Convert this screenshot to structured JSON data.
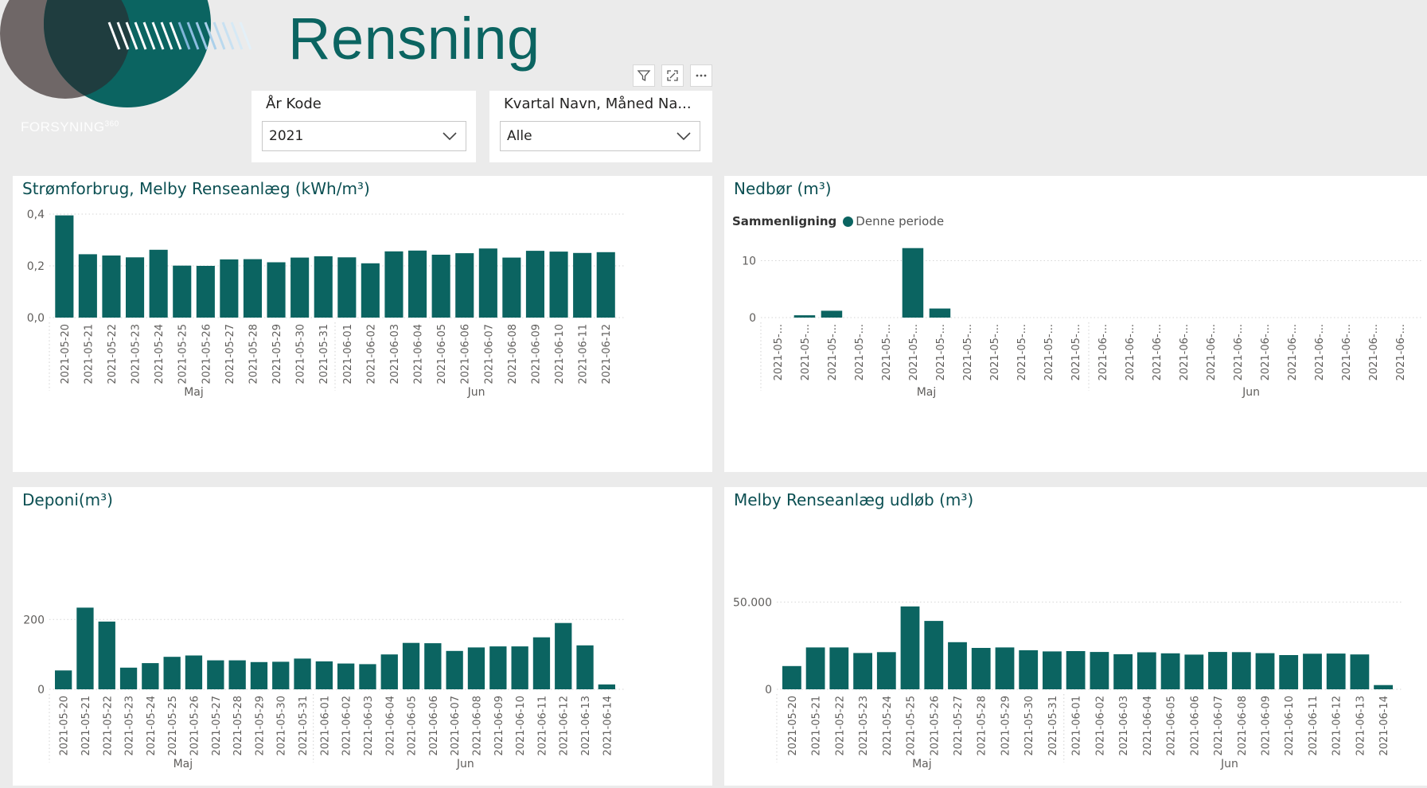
{
  "page": {
    "title": "Rensning",
    "brand": "FORSYNING",
    "brand_suffix": "360",
    "accent_color": "#0b6461"
  },
  "toolbar": {
    "icons": [
      "filter-icon",
      "focus-mode-icon",
      "more-options-icon"
    ]
  },
  "slicers": [
    {
      "label": "År Kode",
      "value": "2021"
    },
    {
      "label": "Kvartal Navn, Måned Na...",
      "value": "Alle"
    }
  ],
  "chart_data": [
    {
      "type": "bar",
      "title": "Strømforbrug, Melby Renseanlæg (kWh/m³)",
      "categories": [
        "2021-05-20",
        "2021-05-21",
        "2021-05-22",
        "2021-05-23",
        "2021-05-24",
        "2021-05-25",
        "2021-05-26",
        "2021-05-27",
        "2021-05-28",
        "2021-05-29",
        "2021-05-30",
        "2021-05-31",
        "2021-06-01",
        "2021-06-02",
        "2021-06-03",
        "2021-06-04",
        "2021-06-05",
        "2021-06-06",
        "2021-06-07",
        "2021-06-08",
        "2021-06-09",
        "2021-06-10",
        "2021-06-11",
        "2021-06-12"
      ],
      "values": [
        0.395,
        0.245,
        0.24,
        0.233,
        0.262,
        0.201,
        0.2,
        0.225,
        0.226,
        0.214,
        0.232,
        0.237,
        0.233,
        0.21,
        0.256,
        0.259,
        0.243,
        0.249,
        0.267,
        0.232,
        0.258,
        0.255,
        0.25,
        0.253
      ],
      "ylim": [
        0,
        0.4
      ],
      "yticks": [
        "0,0",
        "0,2",
        "0,4"
      ],
      "ytick_values": [
        0,
        0.2,
        0.4
      ],
      "groups": [
        {
          "label": "Maj",
          "count": 12
        },
        {
          "label": "Jun",
          "count": 12
        }
      ],
      "color": "#0b6461",
      "grid": true
    },
    {
      "type": "bar",
      "title": "Nedbør (m³)",
      "legend_title": "Sammenligning",
      "legend_items": [
        "Denne periode"
      ],
      "legend_position": "top-left",
      "categories": [
        "2021-05-...",
        "2021-05-...",
        "2021-05-...",
        "2021-05-...",
        "2021-05-...",
        "2021-05-...",
        "2021-05-...",
        "2021-05-...",
        "2021-05-...",
        "2021-05-...",
        "2021-05-...",
        "2021-05-...",
        "2021-06-...",
        "2021-06-...",
        "2021-06-...",
        "2021-06-...",
        "2021-06-...",
        "2021-06-...",
        "2021-06-...",
        "2021-06-...",
        "2021-06-...",
        "2021-06-...",
        "2021-06-...",
        "2021-06-..."
      ],
      "values": [
        0,
        0.4,
        1.2,
        0,
        0,
        12.2,
        1.6,
        0,
        0,
        0,
        0,
        0,
        0,
        0,
        0,
        0,
        0,
        0,
        0,
        0,
        0,
        0,
        0,
        0
      ],
      "ylim": [
        0,
        13
      ],
      "yticks": [
        "0",
        "10"
      ],
      "ytick_values": [
        0,
        10
      ],
      "groups": [
        {
          "label": "Maj",
          "count": 12
        },
        {
          "label": "Jun",
          "count": 12
        }
      ],
      "color": "#0b6461",
      "grid": true
    },
    {
      "type": "bar",
      "title": "Deponi(m³)",
      "categories": [
        "2021-05-20",
        "2021-05-21",
        "2021-05-22",
        "2021-05-23",
        "2021-05-24",
        "2021-05-25",
        "2021-05-26",
        "2021-05-27",
        "2021-05-28",
        "2021-05-29",
        "2021-05-30",
        "2021-05-31",
        "2021-06-01",
        "2021-06-02",
        "2021-06-03",
        "2021-06-04",
        "2021-06-05",
        "2021-06-06",
        "2021-06-07",
        "2021-06-08",
        "2021-06-09",
        "2021-06-10",
        "2021-06-11",
        "2021-06-12",
        "2021-06-13",
        "2021-06-14"
      ],
      "values": [
        54,
        234,
        194,
        62,
        75,
        93,
        97,
        83,
        83,
        78,
        79,
        88,
        80,
        74,
        72,
        100,
        133,
        132,
        110,
        120,
        123,
        123,
        149,
        190,
        126,
        14
      ],
      "ylim": [
        0,
        260
      ],
      "yticks": [
        "0",
        "200"
      ],
      "ytick_values": [
        0,
        200
      ],
      "groups": [
        {
          "label": "Maj",
          "count": 12
        },
        {
          "label": "Jun",
          "count": 14
        }
      ],
      "color": "#0b6461",
      "grid": true
    },
    {
      "type": "bar",
      "title": "Melby Renseanlæg udløb (m³)",
      "categories": [
        "2021-05-20",
        "2021-05-21",
        "2021-05-22",
        "2021-05-23",
        "2021-05-24",
        "2021-05-25",
        "2021-05-26",
        "2021-05-27",
        "2021-05-28",
        "2021-05-29",
        "2021-05-30",
        "2021-05-31",
        "2021-06-01",
        "2021-06-02",
        "2021-06-03",
        "2021-06-04",
        "2021-06-05",
        "2021-06-06",
        "2021-06-07",
        "2021-06-08",
        "2021-06-09",
        "2021-06-10",
        "2021-06-11",
        "2021-06-12",
        "2021-06-13",
        "2021-06-14"
      ],
      "values": [
        13300,
        24000,
        24000,
        20800,
        21300,
        47500,
        39200,
        27000,
        23700,
        24000,
        22400,
        21700,
        21900,
        21400,
        20100,
        21200,
        20600,
        19900,
        21400,
        21300,
        20700,
        19600,
        20400,
        20500,
        20000,
        2400
      ],
      "ylim": [
        0,
        52000
      ],
      "yticks": [
        "0",
        "50.000"
      ],
      "ytick_values": [
        0,
        50000
      ],
      "groups": [
        {
          "label": "Maj",
          "count": 12
        },
        {
          "label": "Jun",
          "count": 14
        }
      ],
      "color": "#0b6461",
      "grid": true
    }
  ]
}
